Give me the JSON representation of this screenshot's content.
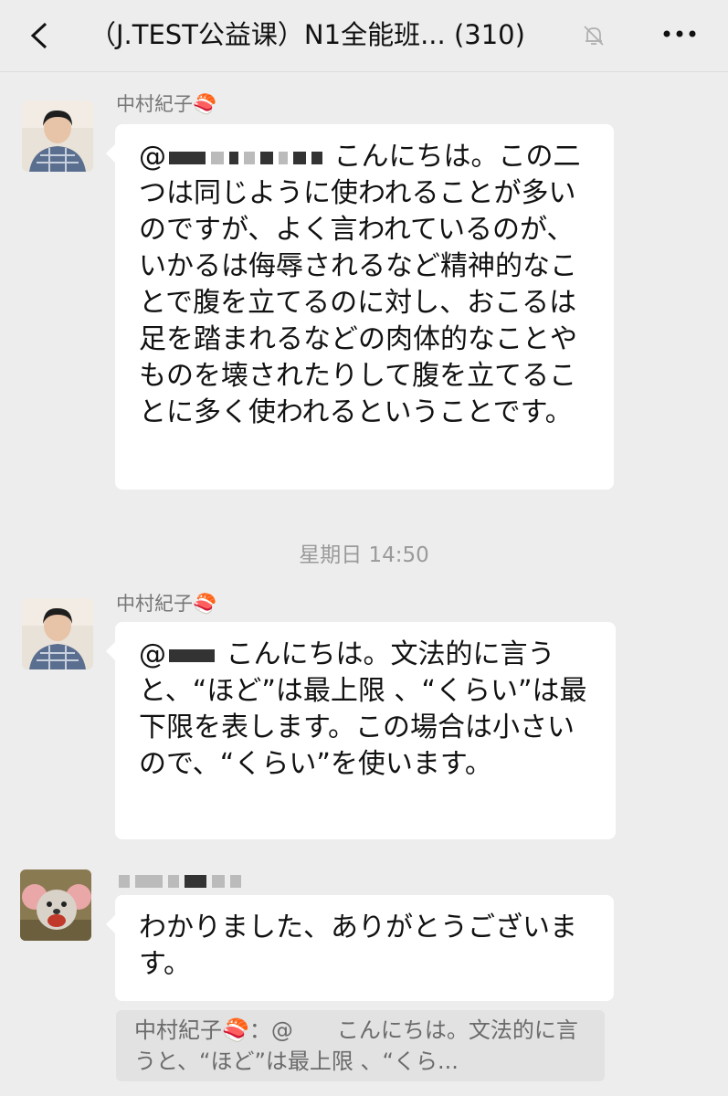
{
  "header": {
    "title": "（J.TEST公益课）N1全能班... (310)",
    "back_icon": "chevron-left-icon",
    "mute_icon": "bell-off-icon",
    "more_icon": "more-icon"
  },
  "messages": [
    {
      "sender": "中村紀子🍣",
      "mention": "@",
      "text": "こんにちは。この二つは同じように使われることが多いのですが、よく言われているのが、いかるは侮辱されるなど精神的なことで腹を立てるのに対し、おこるは足を踏まれるなどの肉体的なことやものを壊されたりして腹を立てることに多く使われるということです。"
    },
    {
      "sender": "中村紀子🍣",
      "mention": "@",
      "text": "こんにちは。文法的に言うと、“ほど”は最上限 、“くらい”は最下限を表します。この場合は小さいので、“くらい”を使います。"
    },
    {
      "sender": "",
      "text": "わかりました、ありがとうございます。"
    }
  ],
  "timestamp": "星期日 14:50",
  "quote": {
    "text": "中村紀子🍣：@　　こんにちは。文法的に言うと、“ほど”は最上限 、“くら..."
  },
  "colors": {
    "background": "#ededed",
    "bubble": "#ffffff",
    "quote_bg": "#e2e2e2"
  }
}
